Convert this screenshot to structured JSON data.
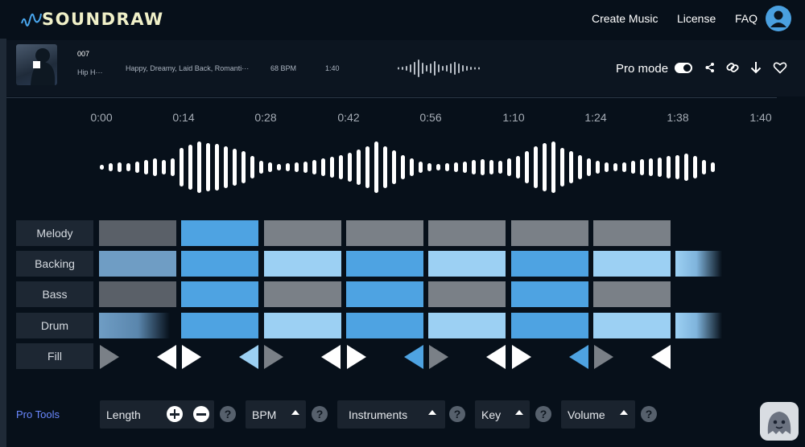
{
  "header": {
    "brand": "SOUNDRAW",
    "nav": [
      "Create Music",
      "License",
      "FAQ"
    ],
    "avatar_icon": "user-avatar-icon"
  },
  "track": {
    "id": "007",
    "genre": "Hip H···",
    "moods": "Happy, Dreamy, Laid Back, Romanti···",
    "bpm": "68 BPM",
    "length": "1:40",
    "pro_mode_label": "Pro mode",
    "pro_mode_on": true,
    "actions": [
      "share-icon",
      "link-icon",
      "download-icon",
      "heart-icon"
    ]
  },
  "timeline": {
    "marks": [
      "0:00",
      "0:14",
      "0:28",
      "0:42",
      "0:56",
      "1:10",
      "1:24",
      "1:38",
      "1:40"
    ]
  },
  "lanes": {
    "melody": "Melody",
    "backing": "Backing",
    "bass": "Bass",
    "drum": "Drum",
    "fill": "Fill"
  },
  "colors": {
    "gray_dark": "#5a6068",
    "gray": "#7a8087",
    "blue": "#4ea3e2",
    "light_blue": "#9cd0f3",
    "steel": "#6f9dc4",
    "accent": "#6a88ff",
    "brand_text": "#f0f0c8"
  },
  "pro_tools": {
    "title": "Pro Tools",
    "length": "Length",
    "bpm": "BPM",
    "instruments": "Instruments",
    "key": "Key",
    "volume": "Volume",
    "help": "?"
  },
  "chat_icon": "chat-mascot-icon"
}
